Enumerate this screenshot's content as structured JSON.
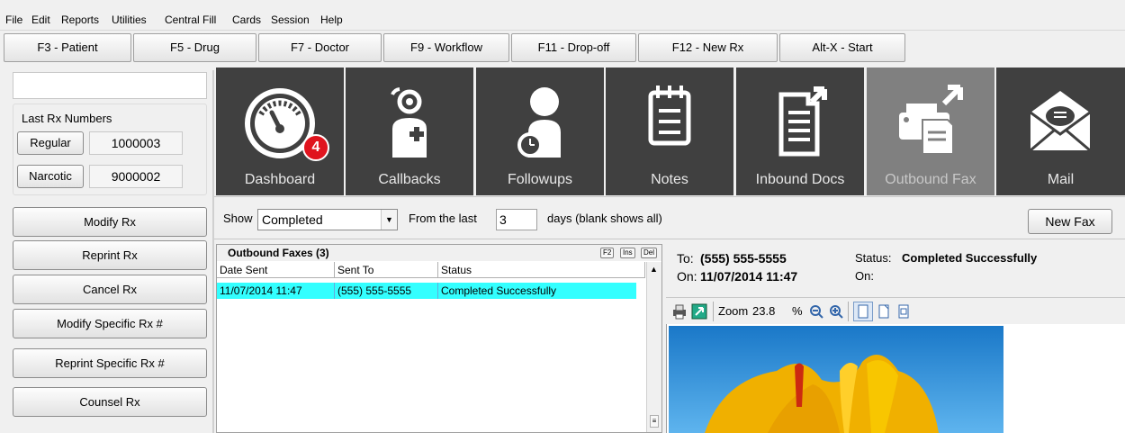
{
  "menu": {
    "file": "File",
    "edit": "Edit",
    "reports": "Reports",
    "utilities": "Utilities",
    "central_fill": "Central Fill",
    "cards": "Cards",
    "session": "Session",
    "help": "Help"
  },
  "fkeys": {
    "patient": "F3 - Patient",
    "drug": "F5 - Drug",
    "doctor": "F7 - Doctor",
    "workflow": "F9 - Workflow",
    "dropoff": "F11 - Drop-off",
    "newrx": "F12 - New Rx",
    "start": "Alt-X - Start"
  },
  "left": {
    "search_value": "",
    "last_rx_title": "Last Rx Numbers",
    "regular_label": "Regular",
    "regular_value": "1000003",
    "narcotic_label": "Narcotic",
    "narcotic_value": "9000002",
    "buttons": {
      "modify": "Modify Rx",
      "reprint": "Reprint Rx",
      "cancel": "Cancel Rx",
      "modify_specific": "Modify Specific Rx #",
      "reprint_specific": "Reprint Specific Rx #",
      "counsel": "Counsel Rx"
    }
  },
  "tiles": {
    "dashboard": "Dashboard",
    "dashboard_badge": "4",
    "callbacks": "Callbacks",
    "followups": "Followups",
    "notes": "Notes",
    "inbound_docs": "Inbound Docs",
    "outbound_fax": "Outbound Fax",
    "mail": "Mail"
  },
  "filter": {
    "show_label": "Show",
    "show_value": "Completed",
    "from_label": "From the last",
    "days_value": "3",
    "days_label": "days (blank shows all)",
    "new_fax": "New Fax"
  },
  "fax_list": {
    "title": "Outbound Faxes (3)",
    "keys": [
      "F2",
      "Ins",
      "Del"
    ],
    "columns": [
      "Date Sent",
      "Sent To",
      "Status"
    ],
    "rows": [
      {
        "date_sent": "11/07/2014 11:47",
        "sent_to": "(555) 555-5555",
        "status": "Completed Successfully"
      }
    ]
  },
  "detail": {
    "to_label": "To:",
    "to_value": "(555) 555-5555",
    "on_label": "On:",
    "on_value": "11/07/2014 11:47",
    "status_label": "Status:",
    "status_value": "Completed Successfully",
    "on2_label": "On:",
    "zoom_label": "Zoom",
    "zoom_value": "23.8",
    "percent": "%"
  },
  "colors": {
    "tile_bg": "#404040",
    "tile_active_bg": "#808080",
    "selected_row": "#33ffff",
    "badge": "#e0141e"
  }
}
